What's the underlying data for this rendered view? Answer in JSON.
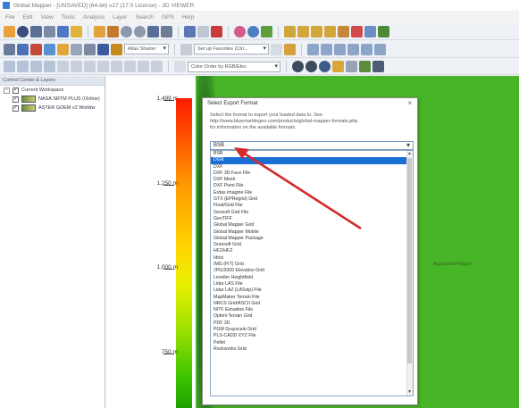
{
  "window": {
    "title": "Global Mapper - [UNSAVED] (64-bit) v17 (17.0 License) - 3D VIEWER"
  },
  "menu": [
    "File",
    "Edit",
    "View",
    "Tools",
    "Analysis",
    "Layer",
    "Search",
    "GPS",
    "Help"
  ],
  "toolbar2": {
    "combo1": "Atlas Shader",
    "combo2": "Set up Favorites (Ctrl...",
    "combo3": ""
  },
  "toolbar3": {
    "combo1": "Color Order by RGB/Elev"
  },
  "control_center": {
    "header": "Control Center & Layers",
    "workspace": "Current Workspace",
    "layers": [
      "NASA SRTM PLUS (Online)",
      "ASTER GDEM v2 Worldw"
    ]
  },
  "legend": {
    "ticks": [
      "1,499 m",
      "1,250 m",
      "1,000 m",
      "750 m"
    ],
    "colors": [
      "#ff1a00",
      "#ffd400",
      "#3cc400"
    ]
  },
  "map": {
    "label": "Aug ExtentPolygon"
  },
  "dialog": {
    "title": "Select Export Format",
    "description": "Select the format to export your loaded data to. See http://www.bluemarblegeo.com/products/global-mapper-formats.php for information on the available formats.",
    "selected_value": "BSB",
    "options": [
      "BSB",
      "DGN",
      "DXF",
      "DXF 3D Face File",
      "DXF Mesh",
      "DXF Point File",
      "Erdas Imagine File",
      "GTX (EPRegrid) Grid",
      "Float/Grid File",
      "Geosoft Grid File",
      "GeoTIFF",
      "Global Mapper Grid",
      "Global Mapper Mobile",
      "Global Mapper Package",
      "Gravsoft Grid",
      "HF2/HFZ",
      "Idrisi",
      "IMG (FIT) Grid",
      "JPG/2000 Elevation Grid",
      "Leveller Heightfield",
      "Lidar LAS File",
      "Lidar LAZ (LASzip) File",
      "MapMaker Terrain File",
      "NRCS Grid/ASCII Grid",
      "NITF Elevation File",
      "Optimi Terrain Grid",
      "PDF 3D",
      "PGM Grayscale Grid",
      "PLS-CADD XYZ File",
      "Pellet",
      "Rockworks Grid"
    ],
    "highlighted_index": 1
  },
  "annotation": {
    "arrow_color": "#d42b2b"
  }
}
